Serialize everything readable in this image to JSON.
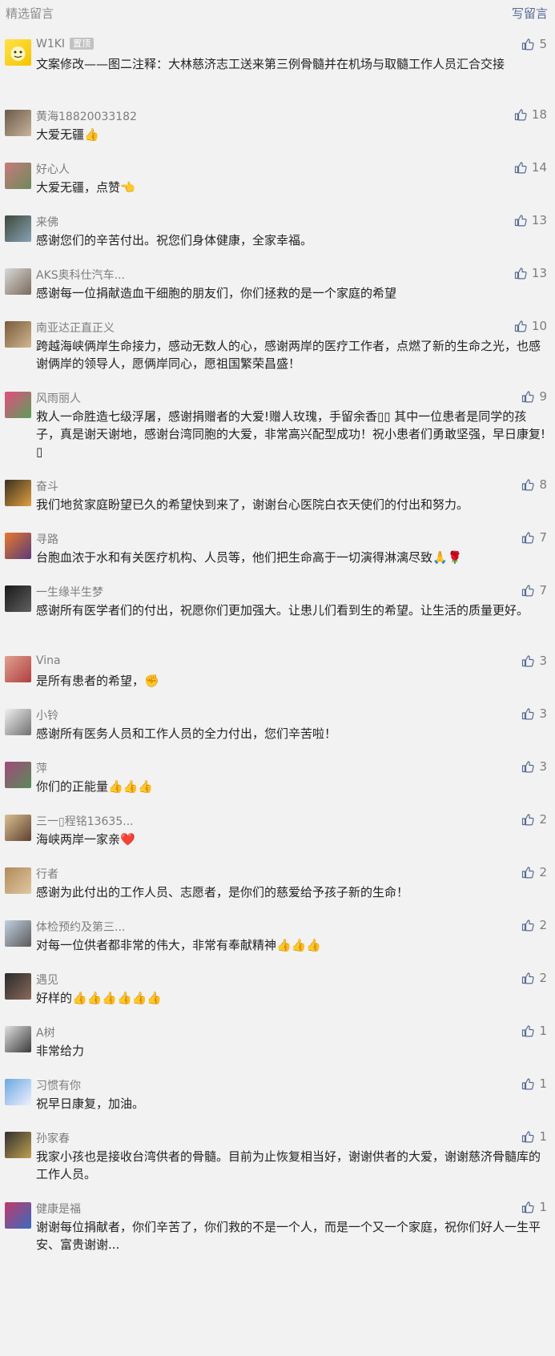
{
  "header": {
    "title": "精选留言",
    "write_label": "写留言"
  },
  "pinned_label": "置顶",
  "comments": [
    {
      "nickname": "W1KI",
      "pinned": true,
      "likes": "5",
      "text": "文案修改——图二注释：大林慈济志工送来第三例骨髓并在机场与取髓工作人员汇合交接"
    },
    {
      "nickname": "黄海18820033182",
      "likes": "18",
      "text": "大爱无疆👍"
    },
    {
      "nickname": "好心人",
      "likes": "14",
      "text": "大爱无疆，点赞👈"
    },
    {
      "nickname": "来佛",
      "likes": "13",
      "text": "感谢您们的辛苦付出。祝您们身体健康，全家幸福。"
    },
    {
      "nickname": "AKS奥科仕汽车...",
      "likes": "13",
      "text": "感谢每一位捐献造血干细胞的朋友们，你们拯救的是一个家庭的希望"
    },
    {
      "nickname": "南亚达正直正义",
      "likes": "10",
      "text": "跨越海峡俩岸生命接力，感动无数人的心，感谢两岸的医疗工作者，点燃了新的生命之光，也感谢俩岸的领导人，愿俩岸同心，愿祖国繁荣昌盛！"
    },
    {
      "nickname": "风雨丽人",
      "likes": "9",
      "text": "救人一命胜造七级浮屠，感谢捐赠者的大爱!赠人玫瑰，手留余香▯▯  其中一位患者是同学的孩子，真是谢天谢地，感谢台湾同胞的大爱，非常高兴配型成功！祝小患者们勇敢坚强，早日康复!▯"
    },
    {
      "nickname": "奋斗",
      "likes": "8",
      "text": "我们地贫家庭盼望已久的希望快到来了，谢谢台心医院白衣天使们的付出和努力。"
    },
    {
      "nickname": "寻路",
      "likes": "7",
      "text": "台胞血浓于水和有关医疗机构、人员等，他们把生命高于一切演得淋漓尽致🙏🌹"
    },
    {
      "nickname": "一生缘半生梦",
      "likes": "7",
      "text": "感谢所有医学者们的付出，祝愿你们更加强大。让患儿们看到生的希望。让生活的质量更好。"
    },
    {
      "nickname": "Vina",
      "likes": "3",
      "text": "是所有患者的希望，✊"
    },
    {
      "nickname": "小铃",
      "likes": "3",
      "text": "感谢所有医务人员和工作人员的全力付出，您们辛苦啦！"
    },
    {
      "nickname": "萍",
      "likes": "3",
      "text": "你们的正能量👍👍👍"
    },
    {
      "nickname": "三一▯程铭13635...",
      "likes": "2",
      "text": "海峡两岸一家亲❤️"
    },
    {
      "nickname": "行者",
      "likes": "2",
      "text": "感谢为此付出的工作人员、志愿者，是你们的慈爱给予孩子新的生命！"
    },
    {
      "nickname": "体检预约及第三...",
      "likes": "2",
      "text": "对每一位供者都非常的伟大，非常有奉献精神👍👍👍"
    },
    {
      "nickname": "遇见",
      "likes": "2",
      "text": "好样的👍👍👍👍👍👍"
    },
    {
      "nickname": "A树",
      "likes": "1",
      "text": "非常给力"
    },
    {
      "nickname": "习惯有你",
      "likes": "1",
      "text": "祝早日康复，加油。"
    },
    {
      "nickname": "孙家春",
      "likes": "1",
      "text": "我家小孩也是接收台湾供者的骨髓。目前为止恢复相当好，谢谢供者的大爱，谢谢慈济骨髓库的工作人员。"
    },
    {
      "nickname": "健康是福",
      "likes": "1",
      "text": "谢谢每位捐献者，你们辛苦了，你们救的不是一个人，而是一个又一个家庭，祝你们好人一生平安、富贵谢谢..."
    }
  ]
}
